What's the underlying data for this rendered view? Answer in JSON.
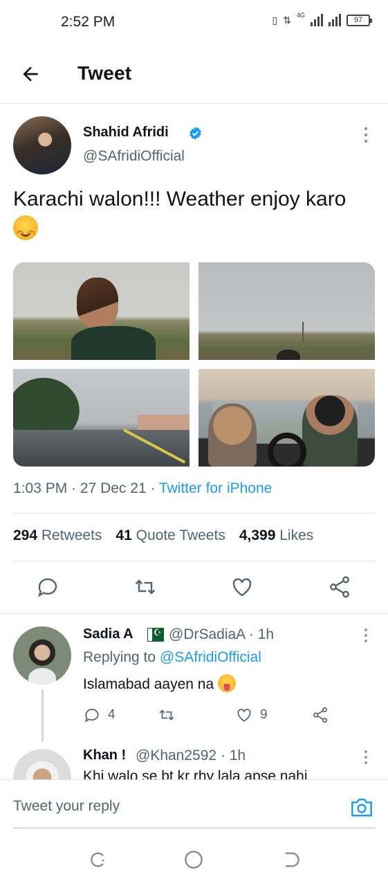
{
  "status_bar": {
    "time": "2:52 PM",
    "network": "4G",
    "battery": "97"
  },
  "header": {
    "title": "Tweet"
  },
  "tweet": {
    "author_name": "Shahid Afridi",
    "author_handle": "@SAfridiOfficial",
    "text": "Karachi walon!!! Weather enjoy karo",
    "time": "1:03 PM",
    "date": "27 Dec 21",
    "source": "Twitter for iPhone",
    "retweets_count": "294",
    "retweets_label": "Retweets",
    "quotes_count": "41",
    "quotes_label": "Quote Tweets",
    "likes_count": "4,399",
    "likes_label": "Likes"
  },
  "replies": [
    {
      "name": "Sadia A",
      "handle": "@DrSadiaA · 1h",
      "replying_prefix": "Replying to",
      "replying_to": "@SAfridiOfficial",
      "text": "Islamabad aayen na",
      "reply_count": "4",
      "like_count": "9"
    },
    {
      "name": "Khan !",
      "handle": "@Khan2592 · 1h",
      "text": "Khi walo se bt kr rhy lala apse nahi"
    }
  ],
  "composer": {
    "placeholder": "Tweet your reply"
  },
  "icons": {
    "back": "arrow-left-icon",
    "verified": "verified-badge-icon",
    "reply": "comment-icon",
    "retweet": "retweet-icon",
    "like": "heart-icon",
    "share": "share-icon",
    "camera": "camera-icon"
  },
  "colors": {
    "accent": "#1d9bf0",
    "secondary_text": "#536471",
    "primary_text": "#0f1419"
  }
}
